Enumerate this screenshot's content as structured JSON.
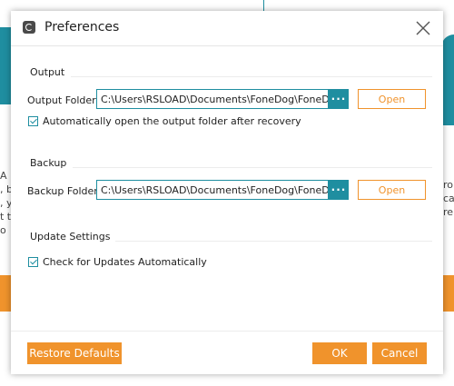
{
  "background": {
    "left_text_lines": [
      "A",
      ", b",
      ", y",
      "t to",
      "o"
    ],
    "right_text_lines": [
      "roi",
      "ca",
      "re"
    ]
  },
  "dialog": {
    "title": "Preferences",
    "icon": "app-logo-icon",
    "close_icon": "close-icon"
  },
  "output": {
    "section_title": "Output",
    "folder_label": "Output Folder:",
    "folder_path": "C:\\Users\\RSLOAD\\Documents\\FoneDog\\FoneDog To",
    "browse_label": "···",
    "open_label": "Open",
    "auto_open_label": "Automatically open the output folder after recovery",
    "auto_open_checked": true
  },
  "backup": {
    "section_title": "Backup",
    "folder_label": "Backup Folder:",
    "folder_path": "C:\\Users\\RSLOAD\\Documents\\FoneDog\\FoneDog To",
    "browse_label": "···",
    "open_label": "Open"
  },
  "update": {
    "section_title": "Update Settings",
    "check_label": "Check for Updates Automatically",
    "check_checked": true
  },
  "footer": {
    "restore_label": "Restore Defaults",
    "ok_label": "OK",
    "cancel_label": "Cancel"
  },
  "colors": {
    "accent_teal": "#1f8ea0",
    "accent_orange": "#f0932c"
  }
}
